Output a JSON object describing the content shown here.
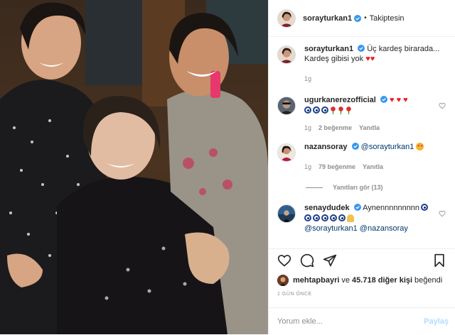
{
  "header": {
    "username": "sorayturkan1",
    "separator": "•",
    "follow_status": "Takiptesin"
  },
  "caption": {
    "username": "sorayturkan1",
    "text": "Üç kardeş birarada... Kardeş gibisi yok",
    "time": "1g"
  },
  "comments": [
    {
      "username": "ugurkanerezofficial",
      "time": "1g",
      "likes": "2 beğenme",
      "reply": "Yanıtla"
    },
    {
      "username": "nazansoray",
      "mention": "@sorayturkan1",
      "time": "1g",
      "likes": "79 beğenme",
      "reply": "Yanıtla",
      "view_replies": "Yanıtları gör (13)"
    },
    {
      "username": "senaydudek",
      "text": "Aynennnnnnnnn",
      "mentions": "@sorayturkan1 @nazansoray"
    }
  ],
  "liked_by": {
    "user": "mehtapbayri",
    "connector": "ve",
    "others": "45.718 diğer kişi",
    "suffix": "beğendi"
  },
  "date": "1 GÜN ÖNCE",
  "add_comment": {
    "placeholder": "Yorum ekle...",
    "share": "Paylaş"
  },
  "colors": {
    "verified": "#3897f0",
    "link": "#00376b",
    "muted": "#8e8e8e",
    "share_disabled": "#b3dbff",
    "heart": "#ed1c24"
  },
  "icons": [
    "verified-badge-icon",
    "heart-icon",
    "comment-icon",
    "share-icon",
    "bookmark-icon",
    "blue-eye-emoji",
    "red-heart-emoji",
    "rose-emoji",
    "praying-hands-emoji"
  ]
}
